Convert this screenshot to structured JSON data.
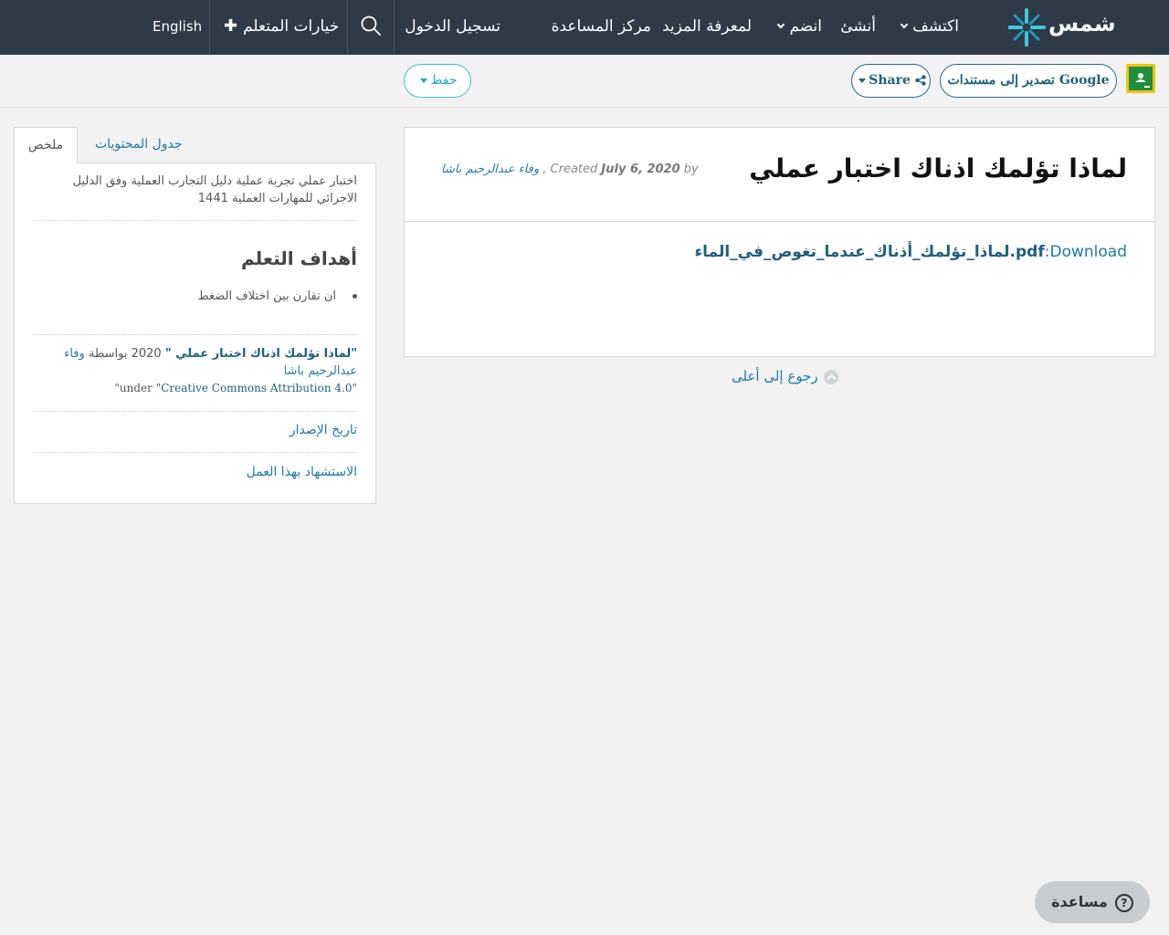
{
  "navbar": {
    "logo_text": "شمس",
    "explore": "اكتشف",
    "create": "أنشئ",
    "join": "انضم",
    "learn_more": "لمعرفة المزيد",
    "help_center": "مركز المساعدة",
    "login": "تسجيل الدخول",
    "learner_options": "خيارات المتعلم",
    "language": "English"
  },
  "toolbar": {
    "export_google": "تصدير إلى مستندات Google",
    "share": "Share",
    "save": "حفظ"
  },
  "resource": {
    "title": "لماذا تؤلمك اذناك اختبار عملي",
    "meta_by": "by",
    "meta_date": "July 6, 2020",
    "meta_created": "Created",
    "meta_author": "وفاء عبدالرحيم باشا",
    "download_label": "Download",
    "download_file": "لماذا_تؤلمك_أذناك_عندما_تغوص_في_الماء.pdf"
  },
  "back_to_top": "رجوع إلى أعلى",
  "sidebar": {
    "tabs": [
      "ملخص",
      "جدول المحتويات"
    ],
    "summary": "اختبار عملي تجربة عملية دليل التجارب العملية وفق الدليل الاجرائي للمهارات العملية 1441",
    "objectives_heading": "أهداف التعلم",
    "objectives": [
      "ان تقارن بين اختلاف الضغط"
    ],
    "credit": {
      "title": "\"لماذا تؤلمك اذناك اختبار عملي \"",
      "year_by": "2020 بواسطة",
      "author": "وفاء عبدالرحيم باشا",
      "license_name": "Creative Commons Attribution 4.0",
      "license_under": "under"
    },
    "version_date": "تاريخ الإصدار",
    "cite": "الاستشهاد بهذا العمل"
  },
  "help_button": "مساعدة",
  "colors": {
    "navbar_bg": "#2e3a48",
    "link": "#1d7aa9",
    "page_bg": "#f1f2f1"
  }
}
